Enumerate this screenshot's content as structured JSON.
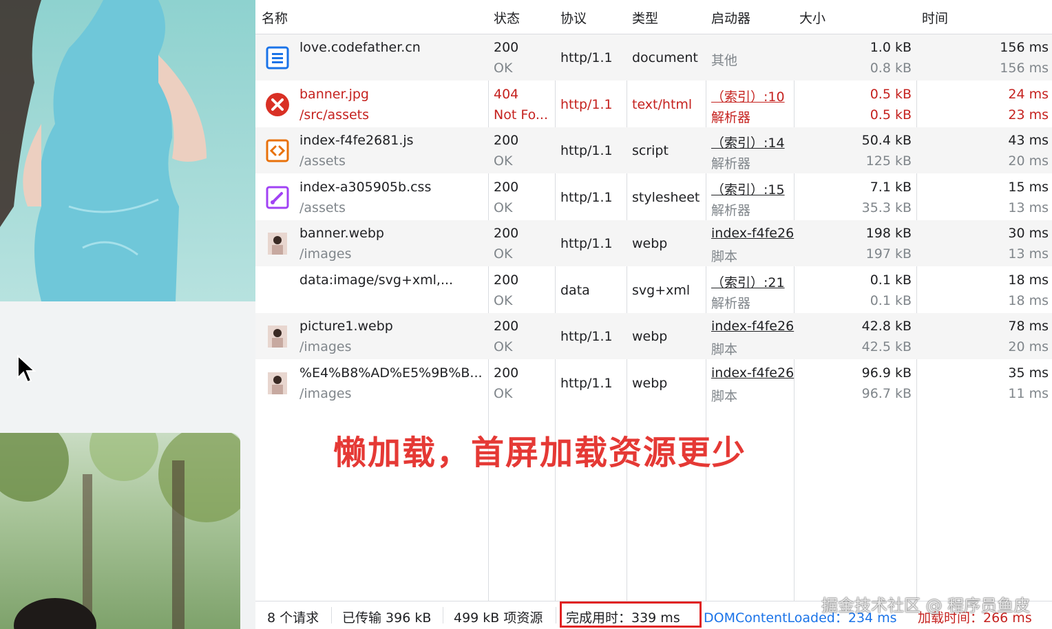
{
  "columns": [
    "名称",
    "状态",
    "协议",
    "类型",
    "启动器",
    "大小",
    "时间"
  ],
  "rows": [
    {
      "name": "love.codefather.cn",
      "path": "",
      "status": "200",
      "status_text": "OK",
      "protocol": "http/1.1",
      "type": "document",
      "initiator": "",
      "initiator_sub": "其他",
      "size": "1.0 kB",
      "size_res": "0.8 kB",
      "time": "156 ms",
      "time_sub": "156 ms",
      "icon": "document-icon",
      "error": false
    },
    {
      "name": "banner.jpg",
      "path": "/src/assets",
      "status": "404",
      "status_text": "Not Fo...",
      "protocol": "http/1.1",
      "type": "text/html",
      "initiator": "（索引）:10",
      "initiator_sub": "解析器",
      "size": "0.5 kB",
      "size_res": "0.5 kB",
      "time": "24 ms",
      "time_sub": "23 ms",
      "icon": "error-icon",
      "error": true
    },
    {
      "name": "index-f4fe2681.js",
      "path": "/assets",
      "status": "200",
      "status_text": "OK",
      "protocol": "http/1.1",
      "type": "script",
      "initiator": "（索引）:14",
      "initiator_sub": "解析器",
      "size": "50.4 kB",
      "size_res": "125 kB",
      "time": "43 ms",
      "time_sub": "20 ms",
      "icon": "script-icon",
      "error": false
    },
    {
      "name": "index-a305905b.css",
      "path": "/assets",
      "status": "200",
      "status_text": "OK",
      "protocol": "http/1.1",
      "type": "stylesheet",
      "initiator": "（索引）:15",
      "initiator_sub": "解析器",
      "size": "7.1 kB",
      "size_res": "35.3 kB",
      "time": "15 ms",
      "time_sub": "13 ms",
      "icon": "stylesheet-icon",
      "error": false
    },
    {
      "name": "banner.webp",
      "path": "/images",
      "status": "200",
      "status_text": "OK",
      "protocol": "http/1.1",
      "type": "webp",
      "initiator": "index-f4fe26",
      "initiator_sub": "脚本",
      "size": "198 kB",
      "size_res": "197 kB",
      "time": "30 ms",
      "time_sub": "13 ms",
      "icon": "image-thumbnail-icon",
      "error": false
    },
    {
      "name": "data:image/svg+xml,...",
      "path": "",
      "status": "200",
      "status_text": "OK",
      "protocol": "data",
      "type": "svg+xml",
      "initiator": "（索引）:21",
      "initiator_sub": "解析器",
      "size": "0.1 kB",
      "size_res": "0.1 kB",
      "time": "18 ms",
      "time_sub": "18 ms",
      "icon": "",
      "error": false
    },
    {
      "name": "picture1.webp",
      "path": "/images",
      "status": "200",
      "status_text": "OK",
      "protocol": "http/1.1",
      "type": "webp",
      "initiator": "index-f4fe26",
      "initiator_sub": "脚本",
      "size": "42.8 kB",
      "size_res": "42.5 kB",
      "time": "78 ms",
      "time_sub": "20 ms",
      "icon": "image-thumbnail-icon",
      "error": false
    },
    {
      "name": "%E4%B8%AD%E5%9B%B...",
      "path": "/images",
      "status": "200",
      "status_text": "OK",
      "protocol": "http/1.1",
      "type": "webp",
      "initiator": "index-f4fe26",
      "initiator_sub": "脚本",
      "size": "96.9 kB",
      "size_res": "96.7 kB",
      "time": "35 ms",
      "time_sub": "11 ms",
      "icon": "image-thumbnail-icon",
      "error": false
    }
  ],
  "footer": {
    "requests": "8 个请求",
    "transferred": "已传输 396 kB",
    "resources": "499 kB 项资源",
    "finish": "完成用时：339 ms",
    "dcl": "DOMContentLoaded：234 ms",
    "load": "加载时间：266 ms"
  },
  "annotation": "懒加载，首屏加载资源更少",
  "watermark": "掘金技术社区 @ 程序员鱼皮",
  "colors": {
    "error": "#c5221f",
    "accent": "#1a73e8",
    "annotation": "#e53935",
    "dcl": "#1a73e8",
    "load": "#c5221f"
  }
}
